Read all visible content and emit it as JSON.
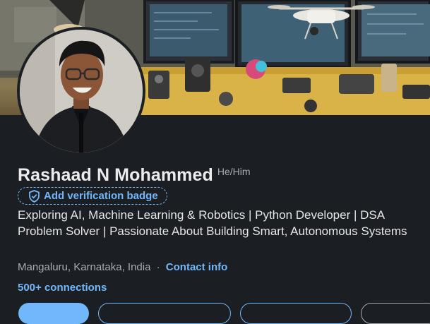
{
  "profile": {
    "name": "Rashaad N Mohammed",
    "pronouns": "He/Him",
    "verification_label": "Add verification badge",
    "headline": "Exploring AI, Machine Learning & Robotics | Python Developer | DSA Problem Solver | Passionate About Building Smart, Autonomous Systems",
    "location": "Mangaluru, Karnataka, India",
    "separator": "·",
    "contact_label": "Contact info",
    "connections_label": "500+ connections"
  },
  "colors": {
    "background": "#1b1f23",
    "link": "#71b7fb",
    "muted": "#a8acb0"
  },
  "icons": {
    "verification": "shield-check-icon"
  }
}
